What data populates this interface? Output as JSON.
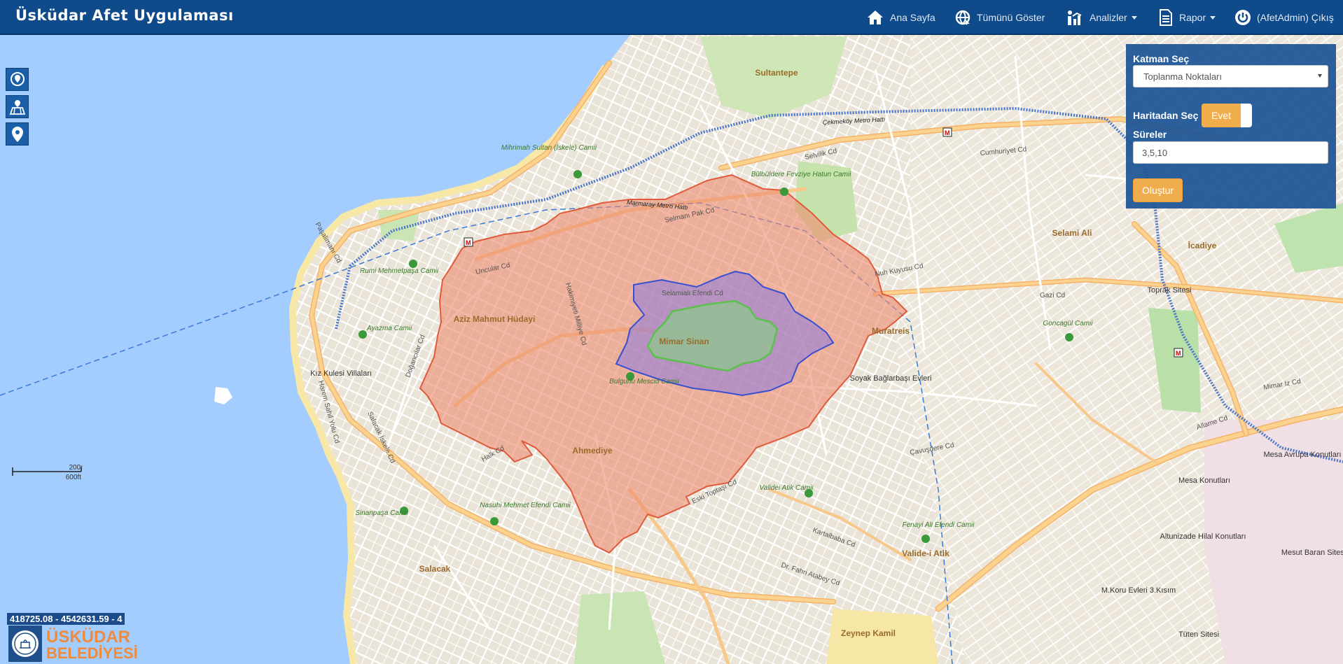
{
  "app": {
    "title": "Üsküdar Afet Uygulaması"
  },
  "nav": {
    "home": "Ana Sayfa",
    "show_all": "Tümünü Göster",
    "analyses": "Analizler",
    "report": "Rapor",
    "logout": "(AfetAdmin) Çıkış"
  },
  "panel": {
    "layer_label": "Katman Seç",
    "layer_value": "Toplanma Noktaları",
    "map_select_label": "Haritadan Seç",
    "map_select_toggle": "Evet",
    "durations_label": "Süreler",
    "durations_value": "3,5,10",
    "create_button": "Oluştur"
  },
  "map": {
    "coordinates": "418725.08 - 4542631.59 - 4",
    "scale_metric": "200m",
    "scale_imperial": "600ft",
    "logo_line1": "ÜSKÜDAR",
    "logo_line2": "BELEDİYESİ",
    "neighborhoods": [
      "Sultantepe",
      "Selami Ali",
      "İcadiye",
      "Aziz Mahmut Hüdayi",
      "Mimar Sinan",
      "Muratreis",
      "Ahmediye",
      "Salacak",
      "Valide-i Atik",
      "Zeynep Kamil",
      "Toprak Sitesi",
      "Kız Kulesi Villaları",
      "Mesa Konutları",
      "Altunizade Hilal Konutları",
      "Mesut Baran Sitesi",
      "M.Koru Evleri 3.Kısım",
      "Tüten Sitesi",
      "Soyak Bağlarbaşı Evleri",
      "Mesa Avrupa Konutları"
    ],
    "mosques": [
      "Mihrimah Sultan (İskele) Camii",
      "Bülbüldere Fevziye Hatun Camii",
      "Rumi Mehmetpaşa Camii",
      "Ayazma Camii",
      "Bulgurlu Mescid Camii",
      "Goncagül Camii",
      "Validei Atik Camii",
      "Fenayi Ali Efendi Camii",
      "Nasuhi Mehmet Efendi Camii",
      "Sinanpaşa Camii"
    ],
    "streets": [
      "Selvilik Cd",
      "Cumhuriyet Cd",
      "Selmanı Pak Cd",
      "Uncular Cd",
      "Gazi Cd",
      "Doğancılar Cd",
      "Halk Cd",
      "Kartalbaba Cd",
      "Dr. Fahri Atabey Cd",
      "Eski Toptaşı Cd",
      "Selamialı Efendi Cd",
      "Nuh Kuyusu Cd",
      "Çavuşdere Cd",
      "Allame Cd",
      "Mimar Iz Cd",
      "Hakimiyeti Milliye Cd",
      "Paşalimanı Cd",
      "Harem Sahil Yolu Cd",
      "Salacak İskele Cd"
    ],
    "metro_lines": [
      "Çekmeköy Metro Hattı",
      "Marmaray Metro Hattı"
    ],
    "isochrones": [
      3,
      5,
      10
    ],
    "layer_colors": {
      "water": "#a3ccff",
      "land": "#f2efe6",
      "park": "#c9e5b3",
      "isochrone_3": "#5cc04e",
      "isochrone_5": "#5e6fd6",
      "isochrone_10": "#e05a3b",
      "navbar": "#0f4a8a"
    }
  }
}
